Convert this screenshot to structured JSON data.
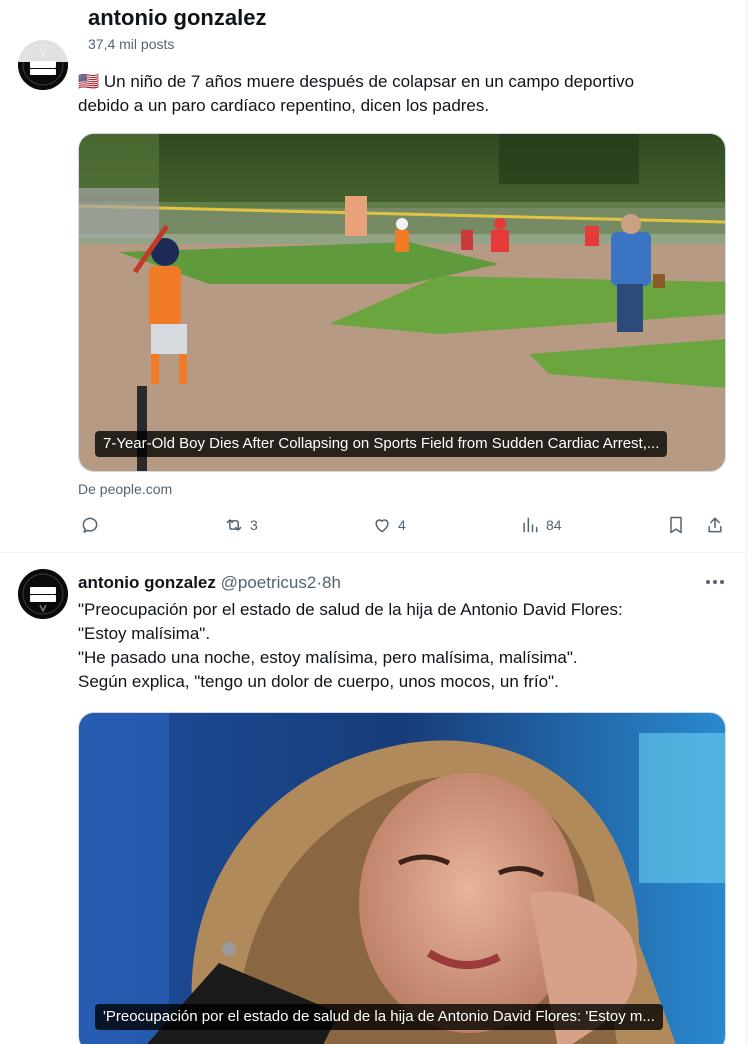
{
  "header": {
    "title": "antonio gonzalez",
    "posts": "37,4 mil posts"
  },
  "tweet1": {
    "avatar_text": "LONG COVID",
    "flag": "🇺🇸",
    "text_line1": "Un niño de 7 años muere después de colapsar en un campo deportivo",
    "text_line2": "debido a un paro cardíaco repentino, dicen los padres.",
    "media_caption": "7-Year-Old Boy Dies After Collapsing on Sports Field from Sudden Cardiac Arrest,...",
    "source": "De people.com",
    "retweets": "3",
    "likes": "4",
    "views": "84"
  },
  "tweet2": {
    "avatar_text": "LONG COVID",
    "name": "antonio gonzalez",
    "handle": "@poetricus2",
    "separator": "·",
    "time": "8h",
    "lines": [
      "\"Preocupación por el estado de salud de la hija de Antonio David Flores:",
      "\"Estoy malísima\".",
      "\"He pasado una noche, estoy malísima, pero malísima, malísima\".",
      "Según explica, \"tengo un dolor de cuerpo, unos mocos, un frío\"."
    ],
    "media_caption": "'Preocupación por el estado de salud de la hija de Antonio David Flores: 'Estoy m..."
  },
  "icons": [
    "reply-icon",
    "retweet-icon",
    "like-icon",
    "views-icon",
    "bookmark-icon",
    "share-icon",
    "more-icon"
  ],
  "colors": {
    "text": "#0f1419",
    "secondary": "#536471",
    "border": "#cfd9de"
  }
}
